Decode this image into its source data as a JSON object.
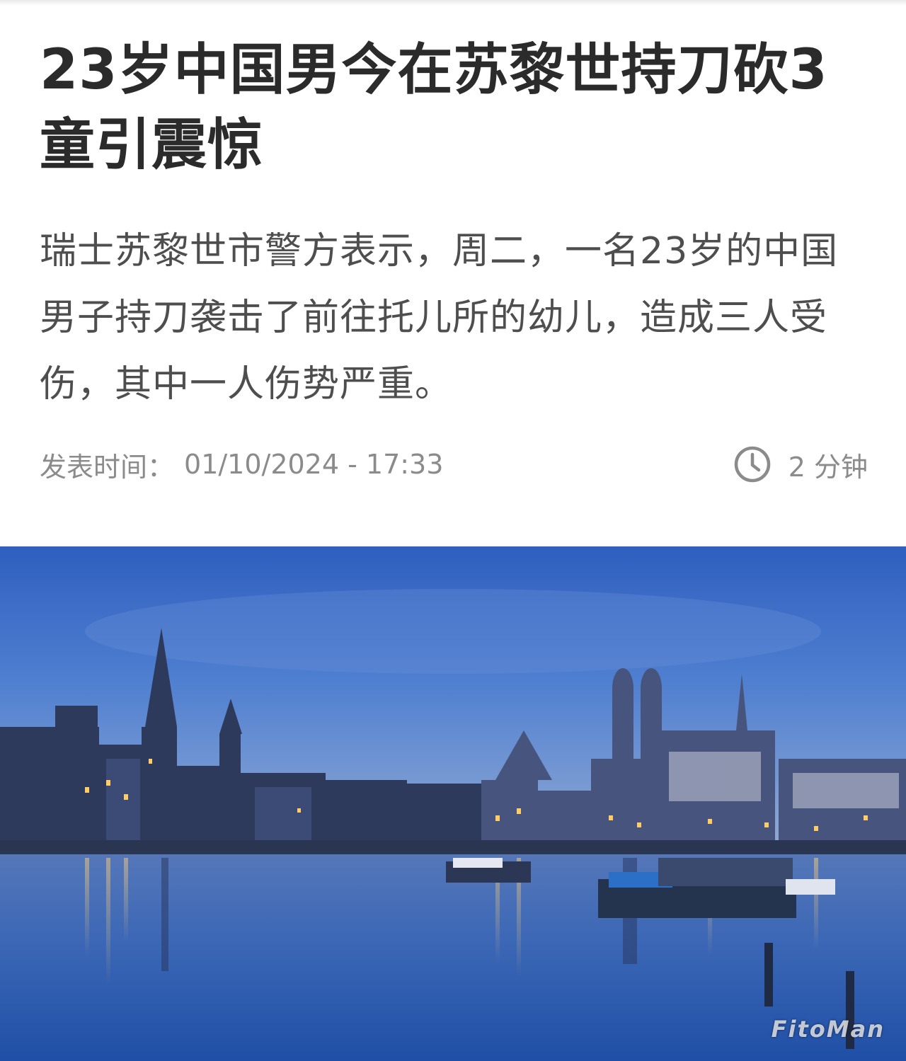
{
  "article": {
    "headline": "23岁中国男今在苏黎世持刀砍3童引震惊",
    "summary": "瑞士苏黎世市警方表示，周二，一名23岁的中国男子持刀袭击了前往托儿所的幼儿，造成三人受伤，其中一人伤势严重。",
    "published_label": "发表时间：",
    "published_value": "01/10/2024 - 17:33",
    "read_time": "2 分钟"
  },
  "hero_image": {
    "subject": "Zurich riverside cityscape at dusk with church spires reflected in the Limmat river",
    "watermark": "FitoMan"
  },
  "icons": {
    "read_time_icon": "clock-icon"
  },
  "colors": {
    "headline": "#2b2b2b",
    "body_text": "#4e4e4e",
    "meta_text": "#8b8b8b",
    "sky": "#3f6fc4",
    "water": "#2d5fb0"
  }
}
